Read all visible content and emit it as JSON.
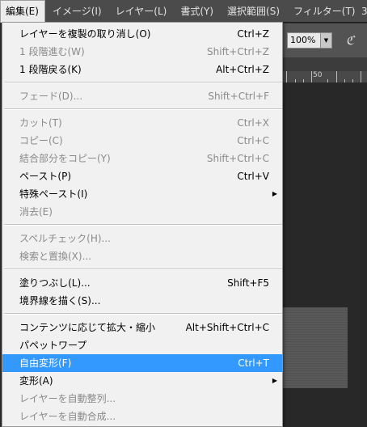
{
  "menubar": {
    "items": [
      "編集(E)",
      "イメージ(I)",
      "レイヤー(L)",
      "書式(Y)",
      "選択範囲(S)",
      "フィルター(T)",
      "3"
    ]
  },
  "options": {
    "zoom": "100%",
    "airbrush_glyph": "ℭ"
  },
  "ruler": {
    "label": "50"
  },
  "menu": {
    "groups": [
      [
        {
          "label": "レイヤーを複製の取り消し(O)",
          "shortcut": "Ctrl+Z",
          "disabled": false
        },
        {
          "label": "1 段階進む(W)",
          "shortcut": "Shift+Ctrl+Z",
          "disabled": true
        },
        {
          "label": "1 段階戻る(K)",
          "shortcut": "Alt+Ctrl+Z",
          "disabled": false
        }
      ],
      [
        {
          "label": "フェード(D)...",
          "shortcut": "Shift+Ctrl+F",
          "disabled": true
        }
      ],
      [
        {
          "label": "カット(T)",
          "shortcut": "Ctrl+X",
          "disabled": true
        },
        {
          "label": "コピー(C)",
          "shortcut": "Ctrl+C",
          "disabled": true
        },
        {
          "label": "結合部分をコピー(Y)",
          "shortcut": "Shift+Ctrl+C",
          "disabled": true
        },
        {
          "label": "ペースト(P)",
          "shortcut": "Ctrl+V",
          "disabled": false
        },
        {
          "label": "特殊ペースト(I)",
          "shortcut": "",
          "disabled": false,
          "submenu": true
        },
        {
          "label": "消去(E)",
          "shortcut": "",
          "disabled": true
        }
      ],
      [
        {
          "label": "スペルチェック(H)...",
          "shortcut": "",
          "disabled": true
        },
        {
          "label": "検索と置換(X)...",
          "shortcut": "",
          "disabled": true
        }
      ],
      [
        {
          "label": "塗りつぶし(L)...",
          "shortcut": "Shift+F5",
          "disabled": false
        },
        {
          "label": "境界線を描く(S)...",
          "shortcut": "",
          "disabled": false
        }
      ],
      [
        {
          "label": "コンテンツに応じて拡大・縮小",
          "shortcut": "Alt+Shift+Ctrl+C",
          "disabled": false
        },
        {
          "label": "パペットワープ",
          "shortcut": "",
          "disabled": false
        },
        {
          "label": "自由変形(F)",
          "shortcut": "Ctrl+T",
          "disabled": false,
          "selected": true
        },
        {
          "label": "変形(A)",
          "shortcut": "",
          "disabled": false,
          "submenu": true
        },
        {
          "label": "レイヤーを自動整列...",
          "shortcut": "",
          "disabled": true
        },
        {
          "label": "レイヤーを自動合成...",
          "shortcut": "",
          "disabled": true
        }
      ]
    ]
  }
}
